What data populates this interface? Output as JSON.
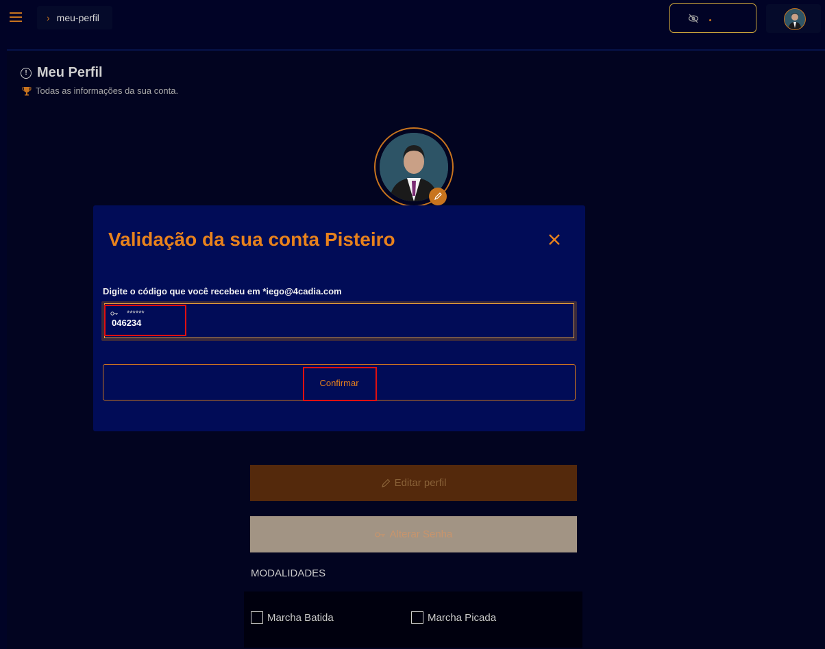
{
  "header": {
    "breadcrumb": "meu-perfil",
    "menu_icon": "hamburger-menu-icon",
    "visibility_icon": "eye-slash-icon"
  },
  "page": {
    "title": "Meu Perfil",
    "subtitle": "Todas as informações da sua conta."
  },
  "modal": {
    "title": "Validação da sua conta Pisteiro",
    "code_label": "Digite o código que você recebeu em *iego@4cadia.com",
    "code_placeholder": "******",
    "code_value": "046234",
    "confirm_label": "Confirmar"
  },
  "actions": {
    "edit_profile_label": "Editar perfil",
    "change_password_label": "Alterar Senha"
  },
  "modalities": {
    "heading": "MODALIDADES",
    "options": [
      "Marcha Batida",
      "Marcha Picada"
    ]
  },
  "colors": {
    "accent": "#e8821c",
    "background": "#010326",
    "modal_bg": "#010c57",
    "highlight": "#e01010"
  }
}
